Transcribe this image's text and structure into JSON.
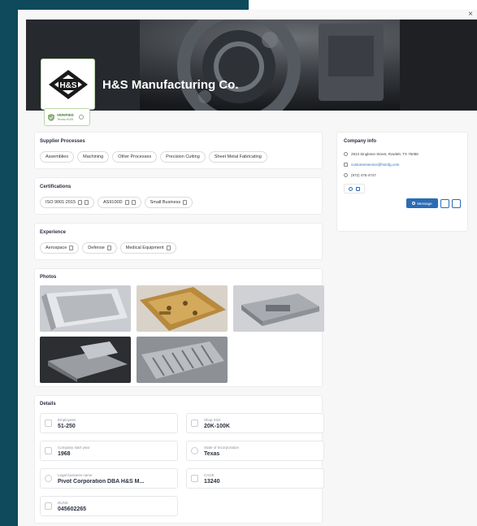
{
  "company": {
    "name": "H&S Manufacturing Co.",
    "logo_text": "H&S",
    "verified_title": "VERIFIED",
    "verified_subtitle": "Texas HUB"
  },
  "close_label": "×",
  "supplier_processes": {
    "title": "Supplier Processes",
    "items": [
      "Assemblies",
      "Machining",
      "Other Processes",
      "Precision Cutting",
      "Sheet Metal Fabricating"
    ]
  },
  "certifications": {
    "title": "Certifications",
    "items": [
      "ISO 9001:2015",
      "AS9100D",
      "Small Business"
    ]
  },
  "experience": {
    "title": "Experience",
    "items": [
      "Aerospace",
      "Defense",
      "Medical Equipment"
    ]
  },
  "photos": {
    "title": "Photos",
    "count": 5
  },
  "details": {
    "title": "Details",
    "items": [
      {
        "label": "Employees",
        "value": "51-250"
      },
      {
        "label": "Shop Size",
        "value": "20K-100K"
      },
      {
        "label": "Company start year",
        "value": "1968"
      },
      {
        "label": "State of Incorporation",
        "value": "Texas"
      },
      {
        "label": "Legal business name",
        "value": "Pivot Corporation DBA H&S M..."
      },
      {
        "label": "CAGE",
        "value": "13240"
      },
      {
        "label": "DUNS",
        "value": "045602265"
      }
    ]
  },
  "company_info": {
    "title": "Company info",
    "address": "2913 Singleton Street, Rowlett, TX 75088",
    "email": "customerservice@hsmfg.com",
    "phone": "(972) 475-4747",
    "message_label": "Message"
  },
  "colors": {
    "accent": "#2b6cb3",
    "backdrop": "#0f4a5c",
    "verified_green": "#8bb07a"
  }
}
